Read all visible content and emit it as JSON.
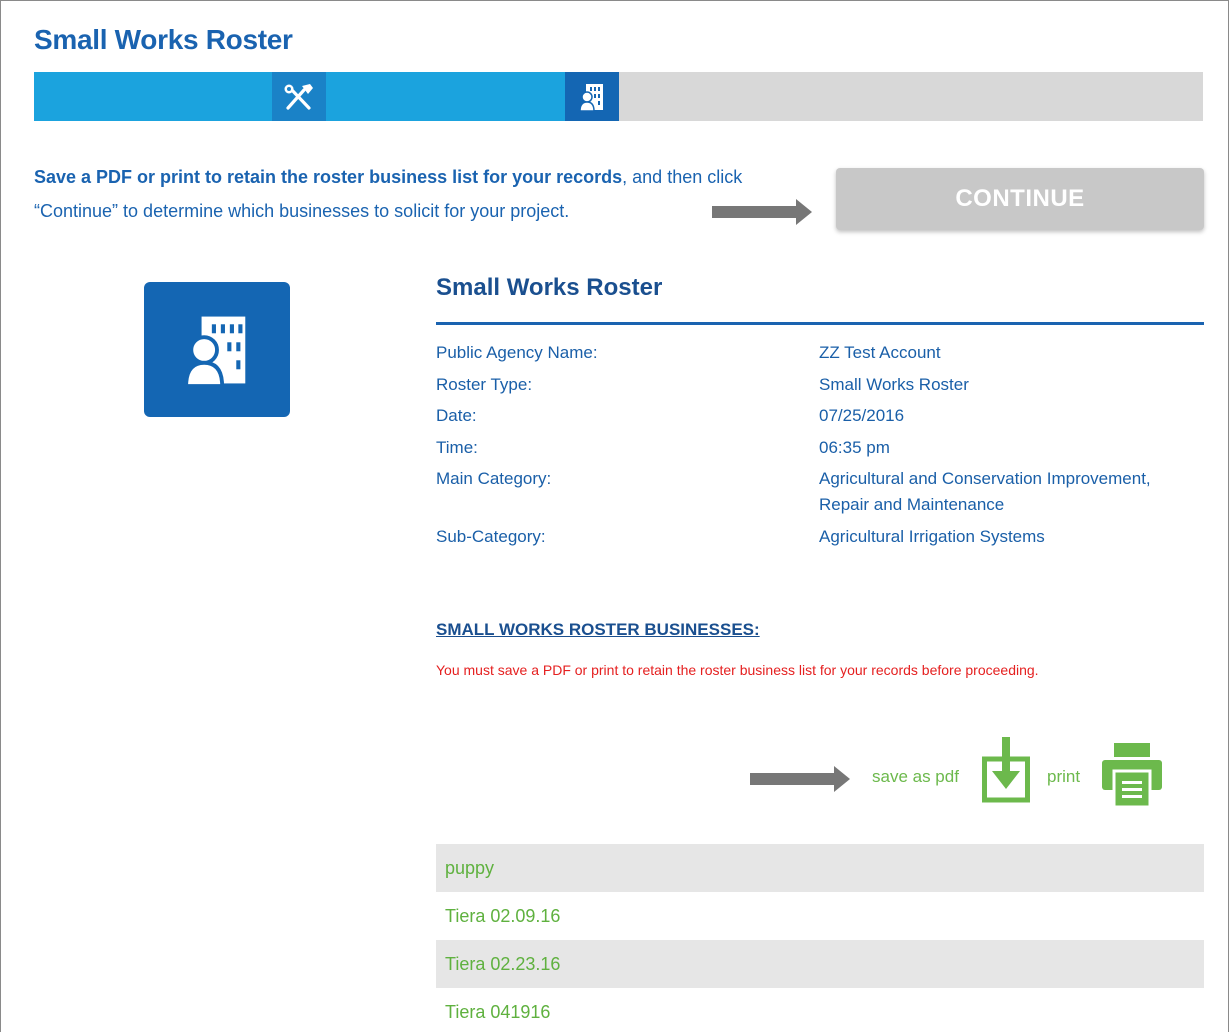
{
  "page": {
    "title": "Small Works Roster"
  },
  "progress": {
    "steps": [
      {
        "icon": "tools-icon",
        "state": "complete"
      },
      {
        "icon": "roster-building-icon",
        "state": "current"
      }
    ],
    "colors": {
      "fill": "#1ba3de",
      "track": "#d8d8d8"
    }
  },
  "intro": {
    "bold_text": "Save a PDF or print to retain the roster business list for your records",
    "rest_text": ", and then click “Continue” to determine which businesses to solicit for your project."
  },
  "continue_button": {
    "label": "CONTINUE",
    "state": "disabled"
  },
  "roster": {
    "logo_icon": "roster-building-icon",
    "section_title": "Small Works Roster",
    "details": [
      {
        "label": "Public Agency Name:",
        "value": "ZZ Test Account"
      },
      {
        "label": "Roster Type:",
        "value": "Small Works Roster"
      },
      {
        "label": "Date:",
        "value": "07/25/2016"
      },
      {
        "label": "Time:",
        "value": "06:35 pm"
      },
      {
        "label": "Main Category:",
        "value": "Agricultural and Conservation Improvement, Repair and Maintenance"
      },
      {
        "label": "Sub-Category:",
        "value": "Agricultural Irrigation Systems"
      }
    ]
  },
  "businesses": {
    "heading": "SMALL WORKS ROSTER BUSINESSES:",
    "warning": "You must save a PDF or print to retain the roster business list for your records before proceeding.",
    "save_pdf_label": "save as pdf",
    "save_pdf_icon": "download-icon",
    "print_label": "print",
    "print_icon": "printer-icon",
    "items": [
      "puppy",
      "Tiera 02.09.16",
      "Tiera 02.23.16",
      "Tiera 041916"
    ]
  },
  "colors": {
    "brand_blue": "#1a63b0",
    "link_green": "#6cb94c",
    "warning_red": "#e52020"
  }
}
